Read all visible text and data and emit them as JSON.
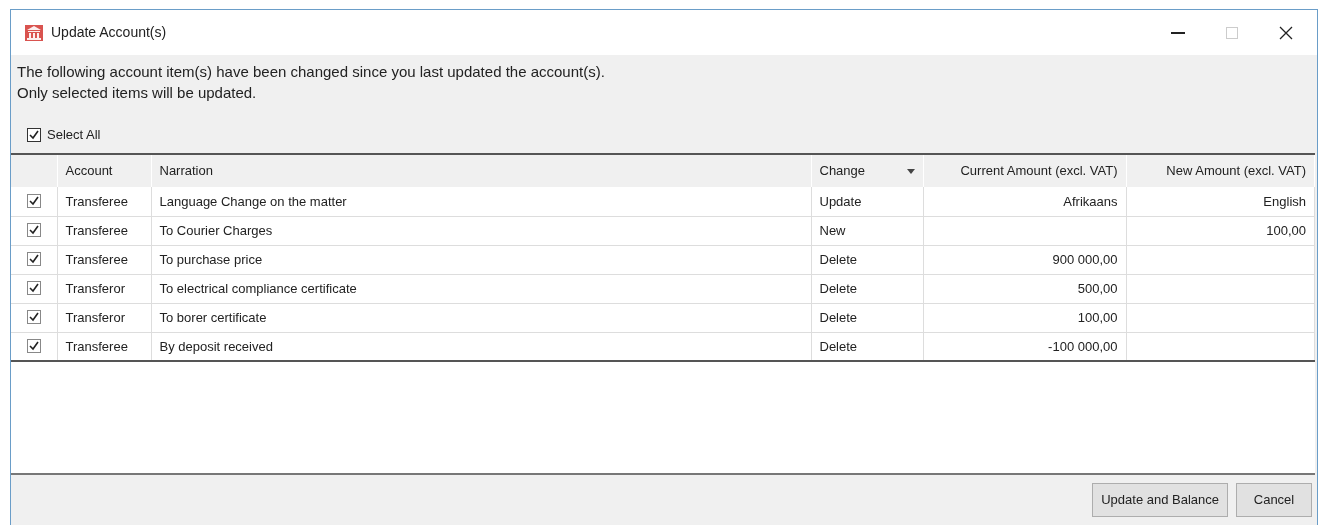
{
  "window": {
    "title": "Update Account(s)"
  },
  "message": [
    "The following account item(s) have been changed since you last updated the account(s).",
    "Only selected items will be updated."
  ],
  "select_all": {
    "label": "Select All",
    "checked": true
  },
  "table": {
    "columns": [
      {
        "label": "Account",
        "dropdown": false
      },
      {
        "label": "Narration",
        "dropdown": false
      },
      {
        "label": "Change",
        "dropdown": true
      },
      {
        "label": "Current Amount (excl. VAT)",
        "dropdown": false
      },
      {
        "label": "New Amount (excl. VAT)",
        "dropdown": false
      }
    ],
    "rows": [
      {
        "checked": true,
        "cells": [
          "Transferee",
          "Language Change on the matter",
          "Update",
          "Afrikaans",
          "English"
        ]
      },
      {
        "checked": true,
        "cells": [
          "Transferee",
          "To Courier Charges",
          "New",
          "",
          "100,00"
        ]
      },
      {
        "checked": true,
        "cells": [
          "Transferee",
          "To purchase price",
          "Delete",
          "900 000,00",
          ""
        ]
      },
      {
        "checked": true,
        "cells": [
          "Transferor",
          "To electrical compliance certificate",
          "Delete",
          "500,00",
          ""
        ]
      },
      {
        "checked": true,
        "cells": [
          "Transferor",
          "To borer certificate",
          "Delete",
          "100,00",
          ""
        ]
      },
      {
        "checked": true,
        "cells": [
          "Transferee",
          "By deposit received",
          "Delete",
          "-100 000,00",
          ""
        ]
      }
    ]
  },
  "buttons": [
    "Update and Balance",
    "Cancel"
  ]
}
